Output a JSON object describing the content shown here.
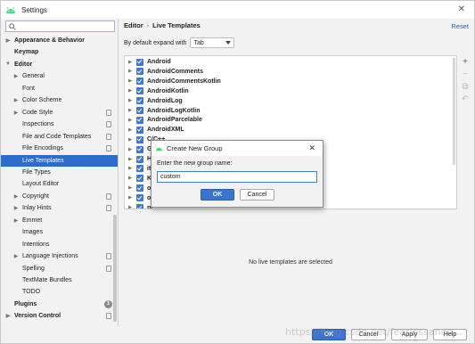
{
  "window": {
    "title": "Settings",
    "close_glyph": "✕"
  },
  "sidebar": {
    "search_placeholder": "",
    "items": [
      {
        "label": "Appearance & Behavior",
        "arrow": "▶",
        "bold": true,
        "indent": 0
      },
      {
        "label": "Keymap",
        "bold": true,
        "indent": 0
      },
      {
        "label": "Editor",
        "arrow": "▼",
        "bold": true,
        "indent": 0
      },
      {
        "label": "General",
        "arrow": "▶",
        "indent": 1
      },
      {
        "label": "Font",
        "indent": 1
      },
      {
        "label": "Color Scheme",
        "arrow": "▶",
        "indent": 1
      },
      {
        "label": "Code Style",
        "arrow": "▶",
        "indent": 1,
        "icon": "page-icon"
      },
      {
        "label": "Inspections",
        "indent": 1,
        "icon": "page-icon"
      },
      {
        "label": "File and Code Templates",
        "indent": 1,
        "icon": "page-icon"
      },
      {
        "label": "File Encodings",
        "indent": 1,
        "icon": "page-icon"
      },
      {
        "label": "Live Templates",
        "indent": 1,
        "selected": true
      },
      {
        "label": "File Types",
        "indent": 1
      },
      {
        "label": "Layout Editor",
        "indent": 1
      },
      {
        "label": "Copyright",
        "arrow": "▶",
        "indent": 1,
        "icon": "page-icon"
      },
      {
        "label": "Inlay Hints",
        "arrow": "▶",
        "indent": 1,
        "icon": "page-icon"
      },
      {
        "label": "Emmet",
        "arrow": "▶",
        "indent": 1
      },
      {
        "label": "Images",
        "indent": 1
      },
      {
        "label": "Intentions",
        "indent": 1
      },
      {
        "label": "Language Injections",
        "arrow": "▶",
        "indent": 1,
        "icon": "page-icon"
      },
      {
        "label": "Spelling",
        "indent": 1,
        "icon": "page-icon"
      },
      {
        "label": "TextMate Bundles",
        "indent": 1
      },
      {
        "label": "TODO",
        "indent": 1
      },
      {
        "label": "Plugins",
        "bold": true,
        "indent": 0,
        "badge": "1"
      },
      {
        "label": "Version Control",
        "arrow": "▶",
        "bold": true,
        "indent": 0,
        "icon": "page-icon"
      }
    ]
  },
  "main": {
    "breadcrumb": {
      "parent": "Editor",
      "separator": "›",
      "current": "Live Templates"
    },
    "reset_label": "Reset",
    "expand_label": "By default expand with",
    "expand_value": "Tab",
    "templates": [
      "Android",
      "AndroidComments",
      "AndroidCommentsKotlin",
      "AndroidKotlin",
      "AndroidLog",
      "AndroidLogKotlin",
      "AndroidParcelable",
      "AndroidXML",
      "C/C++",
      "Gr",
      "HT",
      "ite",
      "Ko",
      "ot",
      "ou",
      "pl"
    ],
    "tools": [
      {
        "glyph": "+",
        "name": "add-icon",
        "disabled": false
      },
      {
        "glyph": "−",
        "name": "remove-icon",
        "disabled": true
      },
      {
        "glyph": "⧉",
        "name": "copy-icon",
        "disabled": true
      },
      {
        "glyph": "↶",
        "name": "restore-icon",
        "disabled": true
      }
    ],
    "empty_message": "No live templates are selected"
  },
  "footer": {
    "ok": "OK",
    "cancel": "Cancel",
    "apply": "Apply",
    "help": "Help"
  },
  "dialog": {
    "title": "Create New Group",
    "close_glyph": "✕",
    "prompt": "Enter the new group name:",
    "input_value": "custom",
    "ok": "OK",
    "cancel": "Cancel"
  },
  "watermark": "https://blog.csdn.net/fearlessanon..."
}
